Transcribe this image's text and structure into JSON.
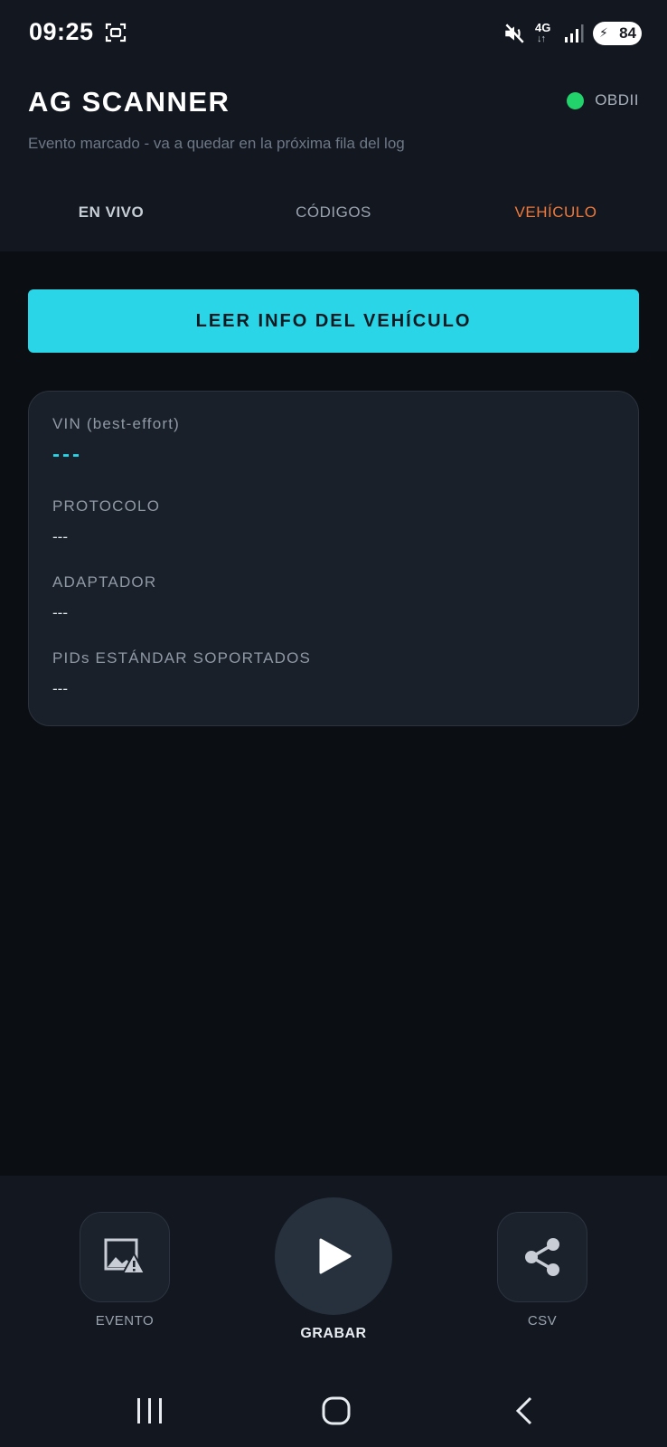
{
  "status_bar": {
    "time": "09:25",
    "network": "4G",
    "network_arrows": "↓↑",
    "battery_level": "84",
    "icons": [
      "screenshot-icon",
      "mute-icon",
      "signal-icon",
      "battery-icon"
    ]
  },
  "header": {
    "title": "AG SCANNER",
    "connection_label": "OBDII",
    "connection_color": "#22d36b",
    "subtitle": "Evento marcado - va a quedar en la próxima fila del log"
  },
  "tabs": [
    {
      "label": "EN VIVO",
      "active": false
    },
    {
      "label": "CÓDIGOS",
      "active": false
    },
    {
      "label": "VEHÍCULO",
      "active": true
    }
  ],
  "main": {
    "read_button_label": "LEER INFO DEL VEHÍCULO",
    "fields": [
      {
        "label": "VIN (best-effort)",
        "value": "---"
      },
      {
        "label": "PROTOCOLO",
        "value": "---"
      },
      {
        "label": "ADAPTADOR",
        "value": "---"
      },
      {
        "label": "PIDs ESTÁNDAR SOPORTADOS",
        "value": "---"
      }
    ]
  },
  "bottom_actions": {
    "event_label": "EVENTO",
    "record_label": "GRABAR",
    "csv_label": "CSV"
  },
  "colors": {
    "accent": "#29d5e6",
    "active_tab": "#f07a3c",
    "background": "#0b0e13",
    "panel": "#121720"
  }
}
